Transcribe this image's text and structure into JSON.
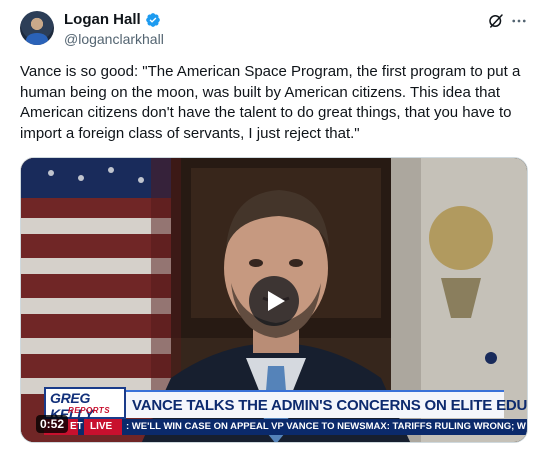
{
  "author": {
    "display_name": "Logan Hall",
    "handle": "@loganclarkhall",
    "verified": true
  },
  "icons": {
    "verified": "verified-badge-icon",
    "grok": "grok-icon",
    "more": "more-icon",
    "play": "play-icon"
  },
  "colors": {
    "verified_blue": "#1d9bf0",
    "text_primary": "#0f1419",
    "text_secondary": "#536471"
  },
  "tweet": {
    "text": "Vance is so good: \"The American Space Program, the first program to put a human being on the moon, was built by American citizens. This idea that American citizens don't have the talent to do great things, that you have to import a foreign class of servants, I just reject that.\""
  },
  "video": {
    "duration": "0:52",
    "chyron": {
      "logo_main": "GREG KELLY",
      "logo_sub": "REPORTS",
      "headline": "VANCE TALKS THE ADMIN'S CONCERNS ON ELITE EDUCATION",
      "ticker_prefix": "ET",
      "live_label": "LIVE",
      "ticker": ": WE'LL WIN CASE ON APPEAL    VP VANCE TO NEWSMAX: TARIFFS RULING WRONG; WE'LL W"
    }
  }
}
